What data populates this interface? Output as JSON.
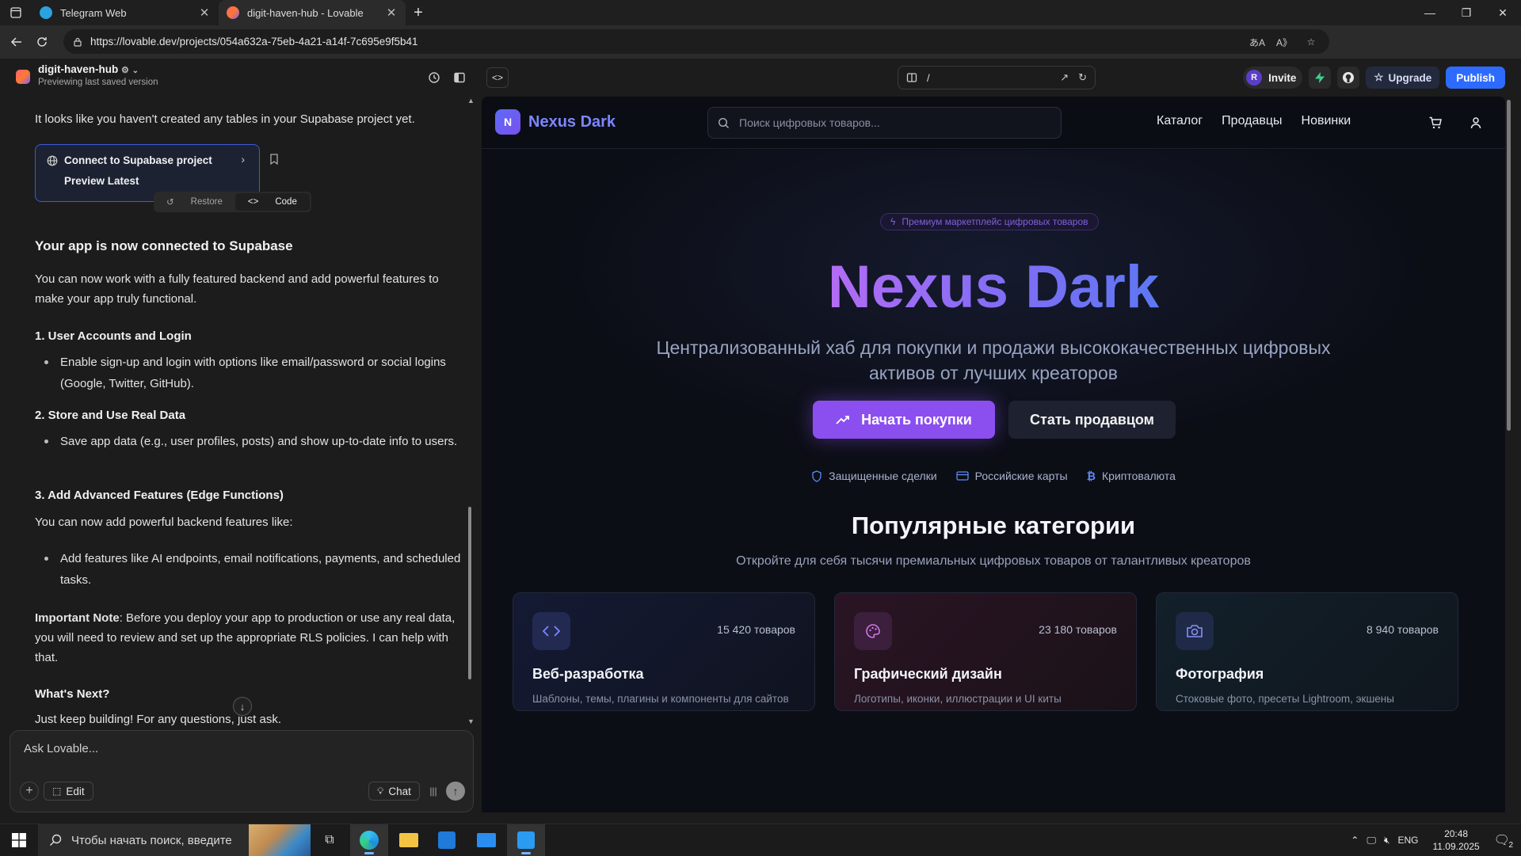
{
  "browser": {
    "tabs": [
      {
        "label": "Telegram Web",
        "active": false
      },
      {
        "label": "digit-haven-hub - Lovable",
        "active": true
      }
    ],
    "url": "https://lovable.dev/projects/054a632a-75eb-4a21-a14f-7c695e9f5b41"
  },
  "app_header": {
    "project_name": "digit-haven-hub",
    "project_status": "Previewing last saved version",
    "path": "/",
    "invite_avatar": "R",
    "invite_label": "Invite",
    "upgrade_label": "Upgrade",
    "publish_label": "Publish"
  },
  "chat": {
    "intro_text": "It looks like you haven't created any tables in your Supabase project yet.",
    "supabase_card": {
      "title": "Connect to Supabase project",
      "subtitle": "Preview Latest"
    },
    "restore_label": "Restore",
    "code_label": "Code",
    "heading": "Your app is now connected to Supabase",
    "paragraph1": "You can now work with a fully featured backend and add powerful features to make your app truly functional.",
    "section1_title": "1. User Accounts and Login",
    "section1_bullet": "Enable sign-up and login with options like email/password or social logins (Google, Twitter, GitHub).",
    "section2_title": "2. Store and Use Real Data",
    "section2_bullet": "Save app data (e.g., user profiles, posts) and show up-to-date info to users.",
    "section3_title": "3. Add Advanced Features (Edge Functions)",
    "section3_intro": "You can now add powerful backend features like:",
    "section3_bullet": "Add features like AI endpoints, email notifications, payments, and scheduled tasks.",
    "note_label": "Important Note",
    "note_text": ": Before you deploy your app to production or use any real data, you will need to review and set up the appropriate RLS policies. I can help with that.",
    "next_title": "What's Next?",
    "next_text": "Just keep building! For any questions, just ask.",
    "input_placeholder": "Ask Lovable...",
    "edit_label": "Edit",
    "chat_label": "Chat"
  },
  "site": {
    "brand_letter": "N",
    "brand_name": "Nexus Dark",
    "search_placeholder": "Поиск цифровых товаров...",
    "menu": [
      "Каталог",
      "Продавцы",
      "Новинки"
    ],
    "badge": "Премиум маркетплейс цифровых товаров",
    "hero_title": "Nexus Dark",
    "hero_subtitle": "Централизованный хаб для покупки и продажи высококачественных цифровых активов от лучших креаторов",
    "cta_primary": "Начать покупки",
    "cta_secondary": "Стать продавцом",
    "trust": [
      "Защищенные сделки",
      "Российские карты",
      "Криптовалюта"
    ],
    "categories_title": "Популярные категории",
    "categories_subtitle": "Откройте для себя тысячи премиальных цифровых товаров от талантливых креаторов",
    "categories": [
      {
        "count": "15 420 товаров",
        "title": "Веб-разработка",
        "desc": "Шаблоны, темы, плагины и компоненты для сайтов",
        "icon": "code-icon",
        "accent": "#6b7bf5"
      },
      {
        "count": "23 180 товаров",
        "title": "Графический дизайн",
        "desc": "Логотипы, иконки, иллюстрации и UI киты",
        "icon": "palette-icon",
        "accent": "#c06bd8"
      },
      {
        "count": "8 940 товаров",
        "title": "Фотография",
        "desc": "Стоковые фото, пресеты Lightroom, экшены",
        "icon": "camera-icon",
        "accent": "#7b82f5"
      }
    ]
  },
  "taskbar": {
    "search_placeholder": "Чтобы начать поиск, введите",
    "language": "ENG",
    "time": "20:48",
    "date": "11.09.2025",
    "notifications": "2"
  },
  "colors": {
    "accent_purple": "#8b4ff0",
    "publish_blue": "#2d6bff",
    "brand_blue": "#7c86ff"
  }
}
